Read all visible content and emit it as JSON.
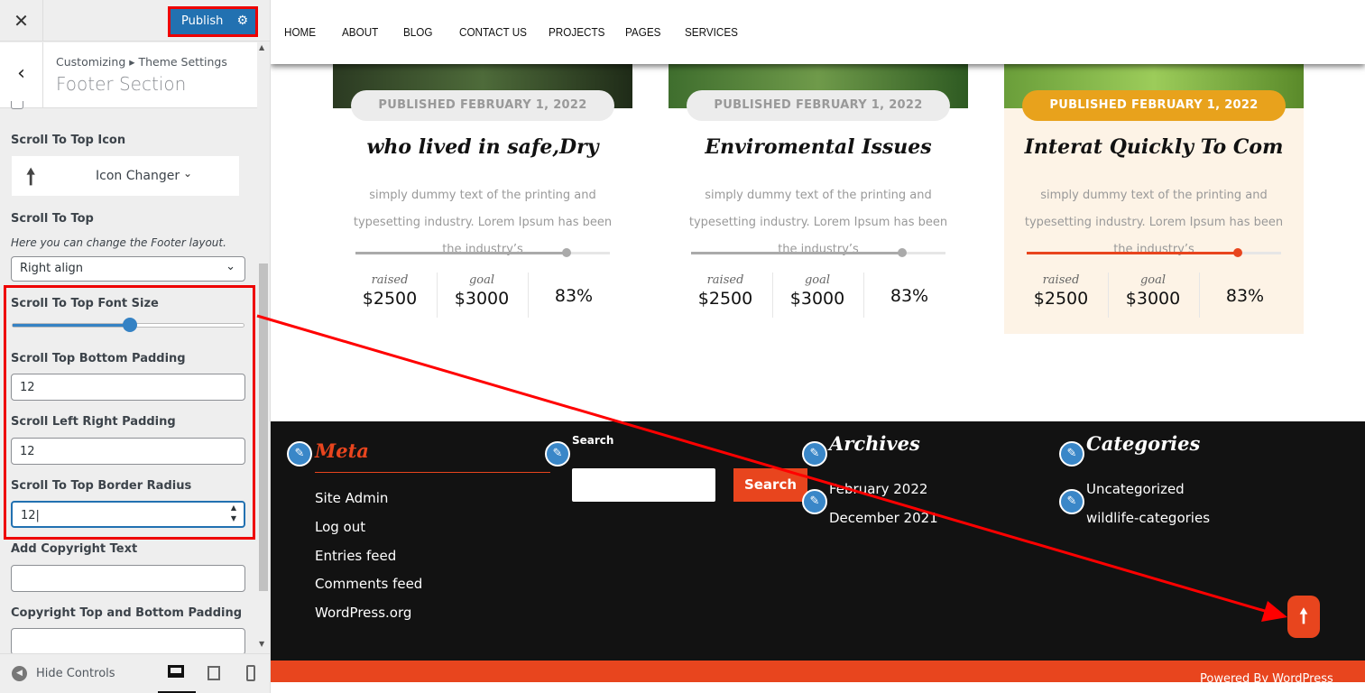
{
  "customizer": {
    "close_icon": "close-icon",
    "publish_label": "Publish",
    "settings_icon": "gear-icon",
    "breadcrumb": "Customizing ▸ Theme Settings",
    "section_title": "Footer Section",
    "scroll_icon_label": "Scroll To Top Icon",
    "icon_changer_label": "Icon Changer",
    "scroll_to_top_label": "Scroll To Top",
    "scroll_to_top_desc": "Here you can change the Footer layout.",
    "alignment_value": "Right align",
    "font_size_label": "Scroll To Top Font Size",
    "font_size_slider_fraction": 0.5,
    "bottom_padding_label": "Scroll Top Bottom Padding",
    "bottom_padding_value": "12",
    "lr_padding_label": "Scroll Left Right Padding",
    "lr_padding_value": "12",
    "border_radius_label": "Scroll To Top Border Radius",
    "border_radius_value": "12",
    "copyright_label": "Add Copyright Text",
    "copyright_value": "",
    "copyright_padding_label": "Copyright Top and Bottom Padding",
    "copyright_padding_value": "",
    "hide_controls": "Hide Controls"
  },
  "preview": {
    "nav": [
      "HOME",
      "ABOUT",
      "BLOG",
      "CONTACT US",
      "PROJECTS",
      "PAGES",
      "SERVICES"
    ],
    "cards": [
      {
        "date": "PUBLISHED FEBRUARY 1, 2022",
        "title": "who lived in safe,Dry",
        "text": "simply dummy text of the printing and typesetting industry. Lorem Ipsum has been the industry’s",
        "progress": 83,
        "raised_label": "raised",
        "raised": "$2500",
        "goal_label": "goal",
        "goal": "$3000",
        "percent": "83%"
      },
      {
        "date": "PUBLISHED FEBRUARY 1, 2022",
        "title": "Enviromental Issues",
        "text": "simply dummy text of the printing and typesetting industry. Lorem Ipsum has been the industry’s",
        "progress": 83,
        "raised_label": "raised",
        "raised": "$2500",
        "goal_label": "goal",
        "goal": "$3000",
        "percent": "83%"
      },
      {
        "date": "PUBLISHED FEBRUARY 1, 2022",
        "title": "Interat Quickly To Com",
        "text": "simply dummy text of the printing and typesetting industry. Lorem Ipsum has been the industry’s",
        "progress": 83,
        "raised_label": "raised",
        "raised": "$2500",
        "goal_label": "goal",
        "goal": "$3000",
        "percent": "83%",
        "highlighted": true
      }
    ],
    "footer": {
      "meta_title": "Meta",
      "meta_links": [
        "Site Admin",
        "Log out",
        "Entries feed",
        "Comments feed",
        "WordPress.org"
      ],
      "search_title": "Search",
      "search_button": "Search",
      "archives_title": "Archives",
      "archives": [
        "February 2022",
        "December 2021"
      ],
      "categories_title": "Categories",
      "categories": [
        "Uncategorized",
        "wildlife-categories"
      ],
      "copyright": "Powered By WordPress"
    },
    "accent": "#e8451e",
    "highlight_pill": "#e8a21c"
  }
}
